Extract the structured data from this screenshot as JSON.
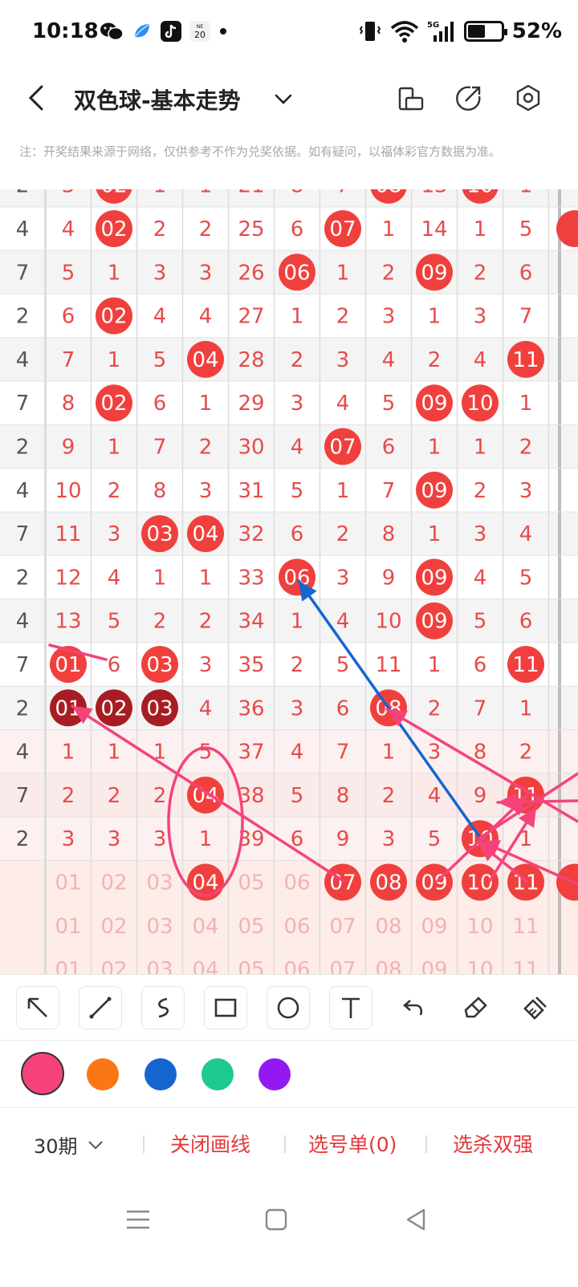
{
  "status_bar": {
    "time": "10:18",
    "battery_percent": "52%",
    "battery_level": 0.52,
    "network": "5G",
    "calendar_day": "20",
    "calendar_top": "NE"
  },
  "header": {
    "title": "双色球-基本走势"
  },
  "notice": "注：开奖结果来源于网络，仅供参考不作为兑奖依据。如有疑问，以福体彩官方数据为准。",
  "grid": {
    "top_partial_row": [
      "2",
      "3",
      "02",
      "1",
      "1",
      "21",
      "8",
      "7",
      "08",
      "13",
      "10",
      "1"
    ],
    "rows": [
      {
        "cells": [
          "4",
          "4",
          "02",
          "2",
          "2",
          "25",
          "6",
          "07",
          "1",
          "14",
          "1",
          "5"
        ],
        "hits": [
          2,
          7
        ]
      },
      {
        "cells": [
          "7",
          "5",
          "1",
          "3",
          "3",
          "26",
          "06",
          "1",
          "2",
          "09",
          "2",
          "6"
        ],
        "hits": [
          6,
          9
        ]
      },
      {
        "cells": [
          "2",
          "6",
          "02",
          "4",
          "4",
          "27",
          "1",
          "2",
          "3",
          "1",
          "3",
          "7"
        ],
        "hits": [
          2
        ]
      },
      {
        "cells": [
          "4",
          "7",
          "1",
          "5",
          "04",
          "28",
          "2",
          "3",
          "4",
          "2",
          "4",
          "11"
        ],
        "hits": [
          4,
          11
        ]
      },
      {
        "cells": [
          "7",
          "8",
          "02",
          "6",
          "1",
          "29",
          "3",
          "4",
          "5",
          "09",
          "10",
          "1"
        ],
        "hits": [
          2,
          9,
          10
        ]
      },
      {
        "cells": [
          "2",
          "9",
          "1",
          "7",
          "2",
          "30",
          "4",
          "07",
          "6",
          "1",
          "1",
          "2"
        ],
        "hits": [
          7
        ]
      },
      {
        "cells": [
          "4",
          "10",
          "2",
          "8",
          "3",
          "31",
          "5",
          "1",
          "7",
          "09",
          "2",
          "3"
        ],
        "hits": [
          9
        ]
      },
      {
        "cells": [
          "7",
          "11",
          "3",
          "03",
          "04",
          "32",
          "6",
          "2",
          "8",
          "1",
          "3",
          "4"
        ],
        "hits": [
          3,
          4
        ]
      },
      {
        "cells": [
          "2",
          "12",
          "4",
          "1",
          "1",
          "33",
          "06",
          "3",
          "9",
          "09",
          "4",
          "5"
        ],
        "hits": [
          6,
          9
        ]
      },
      {
        "cells": [
          "4",
          "13",
          "5",
          "2",
          "2",
          "34",
          "1",
          "4",
          "10",
          "09",
          "5",
          "6"
        ],
        "hits": [
          9
        ]
      },
      {
        "cells": [
          "7",
          "01",
          "6",
          "03",
          "3",
          "35",
          "2",
          "5",
          "11",
          "1",
          "6",
          "11"
        ],
        "hits": [
          1,
          3,
          11
        ]
      },
      {
        "cells": [
          "2",
          "01",
          "02",
          "03",
          "4",
          "36",
          "3",
          "6",
          "08",
          "2",
          "7",
          "1"
        ],
        "hits": [
          1,
          2,
          3,
          8
        ],
        "dark": [
          1,
          2,
          3
        ]
      },
      {
        "cells": [
          "4",
          "1",
          "1",
          "1",
          "5",
          "37",
          "4",
          "7",
          "1",
          "3",
          "8",
          "2"
        ],
        "hits": []
      },
      {
        "cells": [
          "7",
          "2",
          "2",
          "2",
          "04",
          "38",
          "5",
          "8",
          "2",
          "4",
          "9",
          "11"
        ],
        "hits": [
          4,
          11
        ]
      },
      {
        "cells": [
          "2",
          "3",
          "3",
          "3",
          "1",
          "39",
          "6",
          "9",
          "3",
          "5",
          "10",
          "1"
        ],
        "hits": [
          10
        ]
      }
    ],
    "select_row_1": [
      "01",
      "02",
      "03",
      "04",
      "05",
      "06",
      "07",
      "08",
      "09",
      "10",
      "11"
    ],
    "select_row_1_hits": [
      4,
      7,
      8,
      9,
      10,
      11
    ],
    "select_row_2": [
      "01",
      "02",
      "03",
      "04",
      "05",
      "06",
      "07",
      "08",
      "09",
      "10",
      "11"
    ],
    "select_row_3": [
      "01",
      "02",
      "03",
      "04",
      "05",
      "06",
      "07",
      "08",
      "09",
      "10",
      "11"
    ],
    "hit_color": "#f0403e",
    "dark_hit_color": "#a81d23"
  },
  "toolbar": {
    "tools": [
      "arrow-tool",
      "line-tool",
      "curve-tool",
      "rect-tool",
      "circle-tool",
      "text-tool",
      "undo-tool",
      "eraser-tool",
      "clear-tool"
    ]
  },
  "palette": {
    "colors": [
      "#f5437a",
      "#fb7614",
      "#1565d0",
      "#1ec98e",
      "#9319f0"
    ],
    "selected": 0
  },
  "bottom_bar": {
    "period": "30期",
    "close_lines": "关闭画线",
    "pick_list": "选号单(0)",
    "kill_strong": "选杀双强"
  }
}
